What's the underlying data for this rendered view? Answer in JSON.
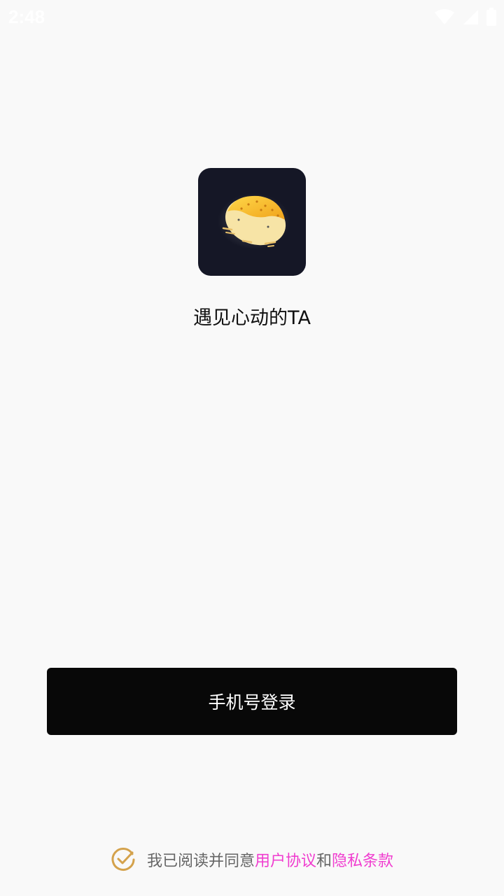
{
  "status_bar": {
    "time": "2:48"
  },
  "app": {
    "slogan": "遇见心动的TA"
  },
  "login": {
    "phone_login_label": "手机号登录"
  },
  "agreement": {
    "prefix": "我已阅读并同意",
    "user_agreement": "用户协议",
    "conjunction": "和",
    "privacy_policy": "隐私条款"
  },
  "colors": {
    "background": "#f9f9f9",
    "button": "#080808",
    "link": "#f03ccf",
    "check": "#d4a24c",
    "logo_bg": "#151726"
  },
  "icons": {
    "status": [
      "wifi-icon",
      "cell-signal-icon",
      "battery-icon"
    ],
    "logo": "bread-logo-icon",
    "agreement": "check-circle-icon"
  }
}
